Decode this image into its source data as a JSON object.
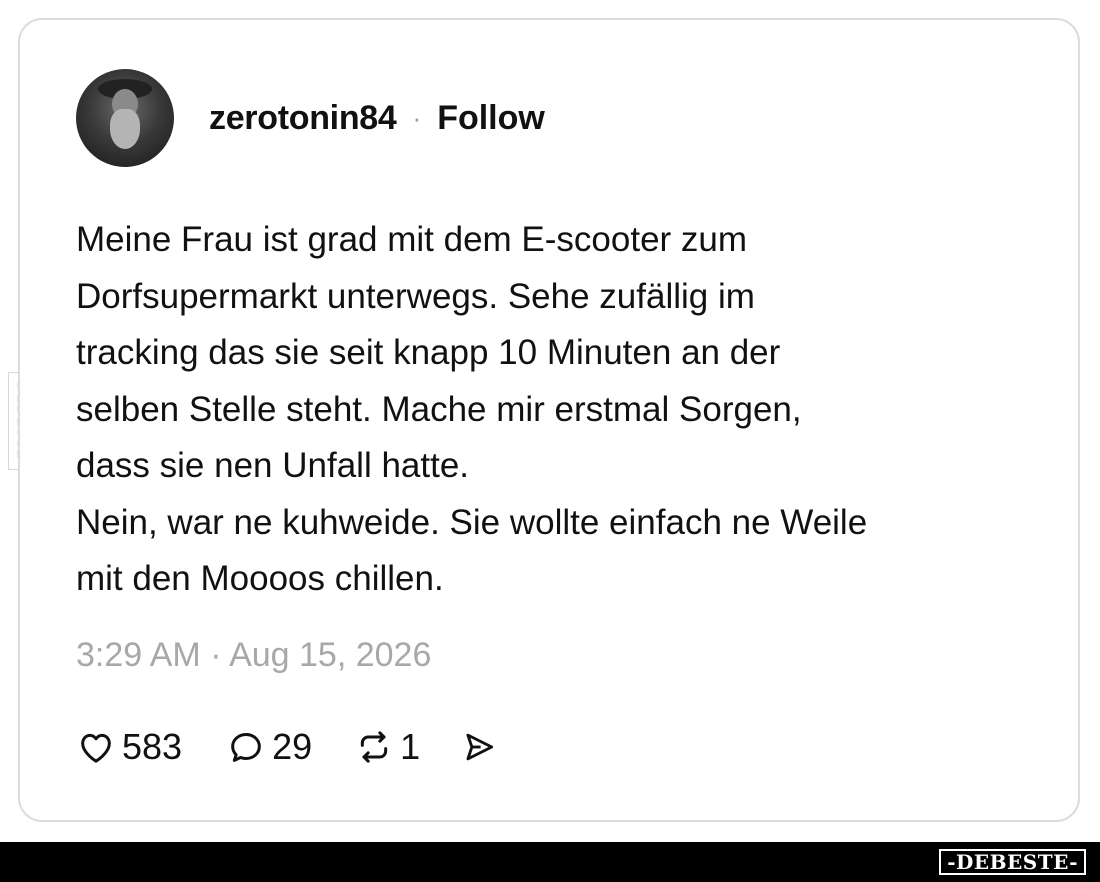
{
  "post": {
    "username": "zerotonin84",
    "separator": "·",
    "follow_label": "Follow",
    "text": "Meine Frau ist grad mit dem E-scooter zum\nDorfsupermarkt unterwegs. Sehe zufällig im\ntracking das sie seit knapp 10 Minuten an der\nselben Stelle steht. Mache mir erstmal Sorgen,\ndass sie nen Unfall hatte.\nNein, war ne kuhweide. Sie wollte einfach ne Weile\nmit den Moooos chillen.",
    "timestamp": "3:29 AM · Aug 15, 2026"
  },
  "actions": {
    "likes": "583",
    "replies": "29",
    "reposts": "1",
    "icons": {
      "like": "heart-icon",
      "reply": "speech-bubble-icon",
      "repost": "repost-arrows-icon",
      "share": "send-icon"
    }
  },
  "watermark": {
    "side_text": "DEBESTE",
    "footer_text": "-DEBESTE-"
  },
  "colors": {
    "text": "#111111",
    "muted": "#a8a8a8",
    "card_border": "#dcdcdc",
    "footer_bg": "#000000"
  }
}
